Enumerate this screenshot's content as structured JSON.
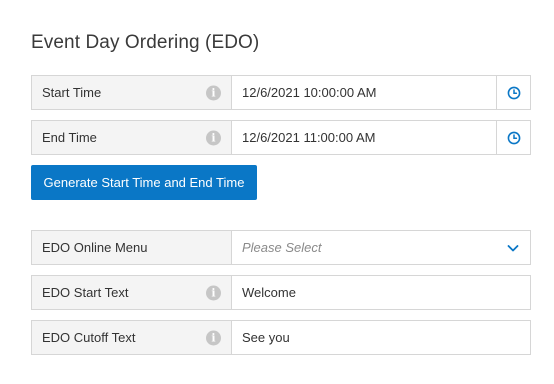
{
  "page": {
    "title": "Event Day Ordering (EDO)"
  },
  "fields": {
    "start_time": {
      "label": "Start Time",
      "value": "12/6/2021 10:00:00 AM",
      "icon": "info-icon",
      "picker_icon": "clock-icon"
    },
    "end_time": {
      "label": "End Time",
      "value": "12/6/2021 11:00:00 AM",
      "icon": "info-icon",
      "picker_icon": "clock-icon"
    },
    "edo_online_menu": {
      "label": "EDO Online Menu",
      "placeholder": "Please Select",
      "icon": "chevron-down-icon"
    },
    "edo_start_text": {
      "label": "EDO Start Text",
      "value": "Welcome",
      "icon": "info-icon"
    },
    "edo_cutoff_text": {
      "label": "EDO Cutoff Text",
      "value": "See you",
      "icon": "info-icon"
    }
  },
  "buttons": {
    "generate_label": "Generate Start Time and End Time"
  },
  "colors": {
    "accent": "#0a77c6",
    "label_bg": "#f4f4f4",
    "border": "#d6d6d6",
    "info_icon": "#c6c6c6"
  }
}
